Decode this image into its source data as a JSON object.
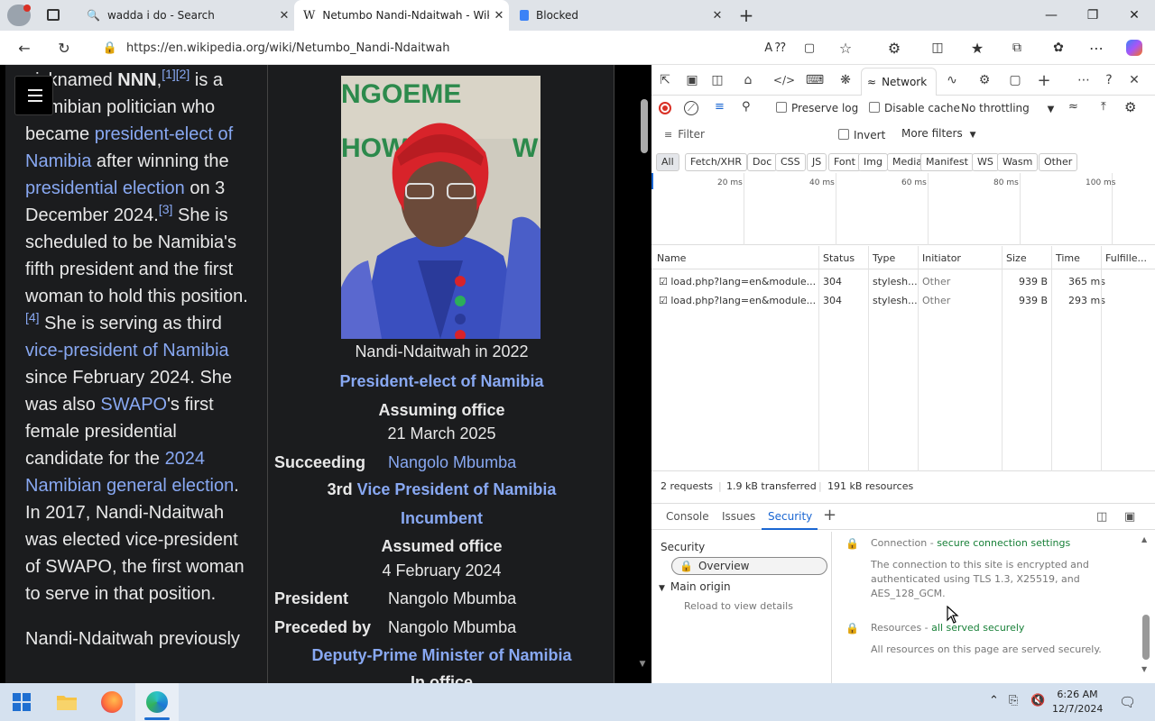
{
  "browser": {
    "tabs": [
      {
        "title": "wadda i do - Search",
        "icon": "search-icon"
      },
      {
        "title": "Netumbo Nandi-Ndaitwah - Wiki",
        "icon": "wikipedia-icon",
        "active": true
      },
      {
        "title": "Blocked",
        "icon": "page-icon"
      }
    ],
    "url": "https://en.wikipedia.org/wiki/Netumbo_Nandi-Ndaitwah",
    "window_controls": {
      "minimize": "—",
      "maximize": "❐",
      "close": "✕"
    }
  },
  "article": {
    "line_fragment": "nicknamed ",
    "nnn": "NNN",
    "refs_1": "[1][2]",
    "p1_a": " is a Namibian politician who became ",
    "link_president_elect": "president-elect of Namibia",
    "p1_b": " after winning the ",
    "link_presidential_election": "presidential election",
    "p1_c": " on 3 December 2024.",
    "ref_3": "[3]",
    "p1_d": " She is scheduled to be Namibia's fifth president and the first woman to hold this position.",
    "ref_4": "[4]",
    "p1_e": " She is serving as third ",
    "link_vice_president": "vice-president of Namibia",
    "p1_f": " since February 2024. She was also ",
    "link_swapo": "SWAPO",
    "p1_g": "'s first female presidential candidate for the ",
    "link_general_election": "2024 Namibian general election",
    "p1_h": ". In 2017, Nandi-Ndaitwah was elected vice-president of SWAPO, the first woman to serve in that position.",
    "p2": "Nandi-Ndaitwah previously"
  },
  "infobox": {
    "caption": "Nandi-Ndaitwah in 2022",
    "office1": "President-elect of Namibia",
    "assuming_label": "Assuming office",
    "assuming_date": "21 March 2025",
    "succeeding_label": "Succeeding",
    "succeeding_value": "Nangolo Mbumba",
    "third": "3rd",
    "office2": "Vice President of Namibia",
    "incumbent": "Incumbent",
    "assumed_label": "Assumed office",
    "assumed_date": "4 February 2024",
    "president_label": "President",
    "president_value": "Nangolo Mbumba",
    "preceded_label": "Preceded by",
    "preceded_value": "Nangolo Mbumba",
    "office3": "Deputy-Prime Minister of Namibia",
    "in_office": "In office",
    "photo_sign_text": "NGOEME HOW W"
  },
  "devtools": {
    "network_tab": "Network",
    "preserve_log": "Preserve log",
    "disable_cache": "Disable cache",
    "throttling": "No throttling",
    "filter_placeholder": "Filter",
    "invert": "Invert",
    "more_filters": "More filters",
    "type_filters": [
      "All",
      "Fetch/XHR",
      "Doc",
      "CSS",
      "JS",
      "Font",
      "Img",
      "Media",
      "Manifest",
      "WS",
      "Wasm",
      "Other"
    ],
    "timeline_labels": [
      "20 ms",
      "40 ms",
      "60 ms",
      "80 ms",
      "100 ms"
    ],
    "columns": [
      "Name",
      "Status",
      "Type",
      "Initiator",
      "Size",
      "Time",
      "Fulfille..."
    ],
    "requests": [
      {
        "name": "load.php?lang=en&module...",
        "status": "304",
        "type": "stylesh...",
        "initiator": "Other",
        "size": "939 B",
        "time": "365 ms"
      },
      {
        "name": "load.php?lang=en&module...",
        "status": "304",
        "type": "stylesh...",
        "initiator": "Other",
        "size": "939 B",
        "time": "293 ms"
      }
    ],
    "summary": {
      "requests": "2 requests",
      "transferred": "1.9 kB transferred",
      "resources": "191 kB resources"
    },
    "drawer_tabs": [
      "Console",
      "Issues",
      "Security"
    ],
    "security": {
      "nav_title": "Security",
      "overview": "Overview",
      "main_origin": "Main origin",
      "reload": "Reload to view details",
      "connection_label": "Connection - ",
      "connection_status": "secure connection settings",
      "connection_desc": "The connection to this site is encrypted and authenticated using TLS 1.3, X25519, and AES_128_GCM.",
      "resources_label": "Resources - ",
      "resources_status": "all served securely",
      "resources_desc": "All resources on this page are served securely."
    }
  },
  "taskbar": {
    "time": "6:26 AM",
    "date": "12/7/2024"
  },
  "colors": {
    "link": "#88a8f2",
    "secure_green": "#188038",
    "active_blue": "#1a66d2"
  }
}
